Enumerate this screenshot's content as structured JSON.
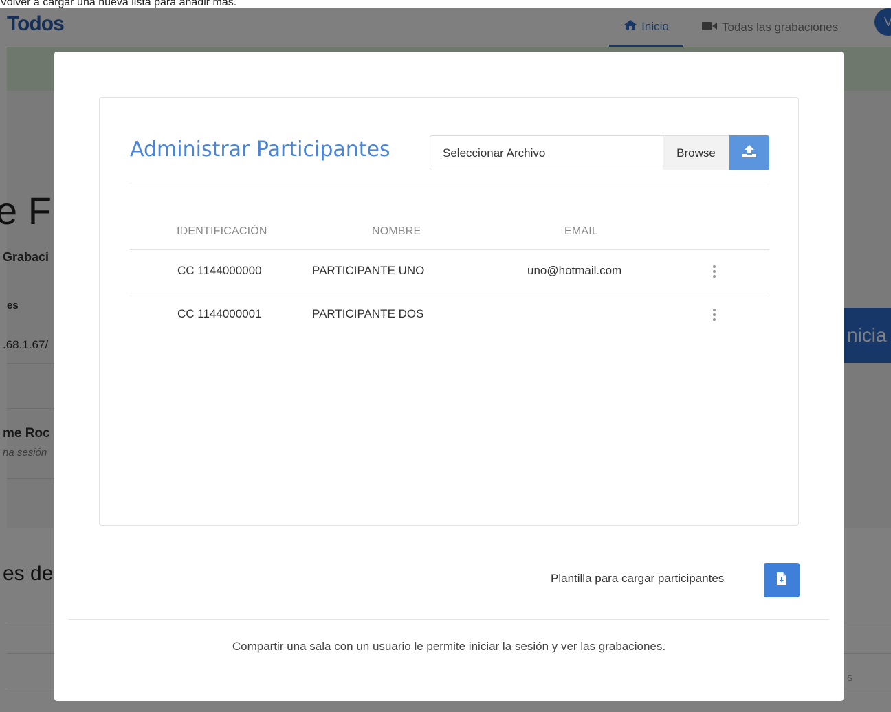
{
  "notice": {
    "text": "Volver a cargar una nueva lista para añadir más."
  },
  "navbar": {
    "brand": "Todos",
    "items": [
      {
        "label": "Inicio",
        "icon": "home-icon",
        "active": true
      },
      {
        "label": "Todas las grabaciones",
        "icon": "video-camera-icon",
        "active": false
      }
    ],
    "avatar_letter": "V"
  },
  "background": {
    "title_fragment": "e F",
    "subtitle_fragment": "Grabaci",
    "label_fragment": "es",
    "url_fragment": ".68.1.67/",
    "room_name_fragment": "me Roc",
    "room_sub_fragment": "na sesión",
    "start_button_fragment": "nicia",
    "section_title_fragment": "es de",
    "right_fragment": "s"
  },
  "modal": {
    "title": "Administrar Participantes",
    "file_input": {
      "placeholder": "Seleccionar Archivo",
      "browse_label": "Browse",
      "upload_icon": "upload-icon"
    },
    "table": {
      "columns": [
        "IDENTIFICACIÓN",
        "NOMBRE",
        "EMAIL"
      ],
      "rows": [
        {
          "id": "CC 1144000000",
          "name": "PARTICIPANTE UNO",
          "email": "uno@hotmail.com"
        },
        {
          "id": "CC 1144000001",
          "name": "PARTICIPANTE DOS",
          "email": ""
        }
      ]
    },
    "template": {
      "label": "Plantilla para cargar participantes",
      "icon": "file-download-icon"
    },
    "footer_note": "Compartir una sala con un usuario le permite iniciar la sesión y ver las grabaciones."
  }
}
